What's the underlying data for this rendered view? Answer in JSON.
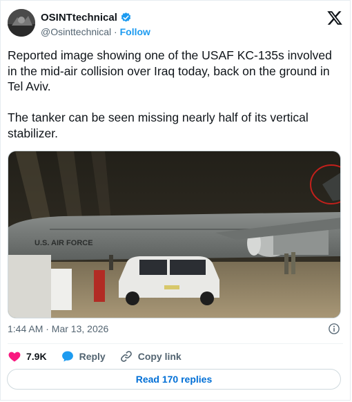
{
  "author": {
    "name": "OSINTtechnical",
    "handle": "@Osinttechnical",
    "separator": "·",
    "follow_label": "Follow"
  },
  "tweet": {
    "text": "Reported image showing one of the USAF KC-135s involved in the mid-air collision over Iraq today, back on the ground in Tel Aviv.\n\nThe tanker can be seen missing nearly half of its vertical stabilizer.",
    "timestamp": "1:44 AM · Mar 13, 2026"
  },
  "media": {
    "aircraft_marking": "U.S. AIR FORCE"
  },
  "actions": {
    "likes": "7.9K",
    "reply_label": "Reply",
    "copy_link_label": "Copy link"
  },
  "replies_button": "Read 170 replies",
  "colors": {
    "brand_blue": "#1d9bf0",
    "like_red": "#f91880",
    "link_blue": "#006fd6",
    "muted": "#536471"
  },
  "icons": [
    "verified-badge-icon",
    "x-logo-icon",
    "info-icon",
    "heart-icon",
    "reply-icon",
    "link-icon"
  ]
}
